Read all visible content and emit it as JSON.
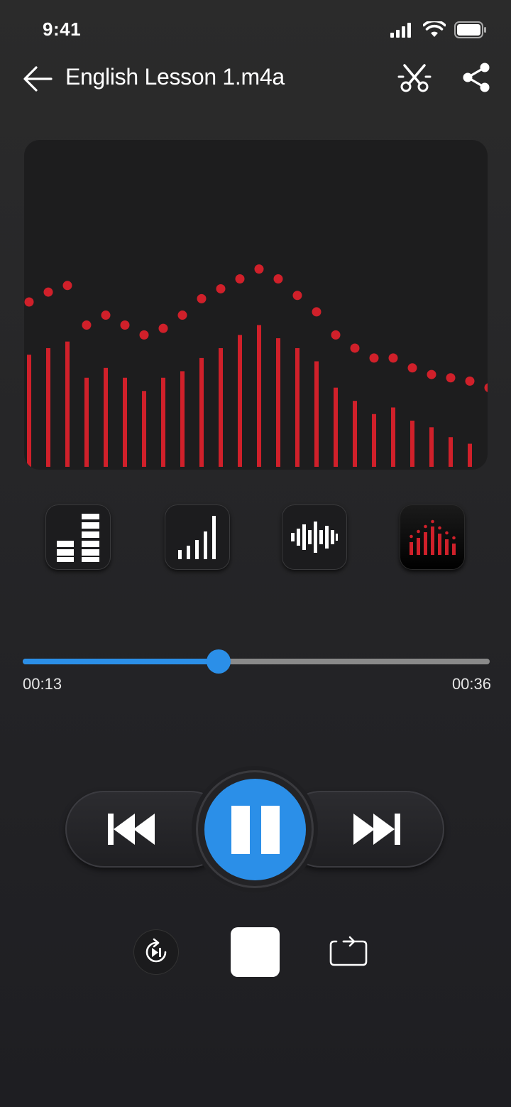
{
  "status_bar": {
    "time": "9:41"
  },
  "header": {
    "title": "English Lesson 1.m4a"
  },
  "visualizer": {
    "bar_levels": [
      0.34,
      0.36,
      0.38,
      0.27,
      0.3,
      0.27,
      0.23,
      0.27,
      0.29,
      0.33,
      0.36,
      0.4,
      0.43,
      0.39,
      0.36,
      0.32,
      0.24,
      0.2,
      0.16,
      0.18,
      0.14,
      0.12,
      0.09,
      0.07
    ],
    "peak_levels": [
      0.5,
      0.53,
      0.55,
      0.43,
      0.46,
      0.43,
      0.4,
      0.42,
      0.46,
      0.51,
      0.54,
      0.57,
      0.6,
      0.57,
      0.52,
      0.47,
      0.4,
      0.36,
      0.33,
      0.33,
      0.3,
      0.28,
      0.27,
      0.26,
      0.24
    ],
    "color": "#d0202a"
  },
  "styles": {
    "active_index": 3
  },
  "progress": {
    "current": "00:13",
    "total": "00:36",
    "fraction": 0.42,
    "accent": "#2b8fe8"
  }
}
